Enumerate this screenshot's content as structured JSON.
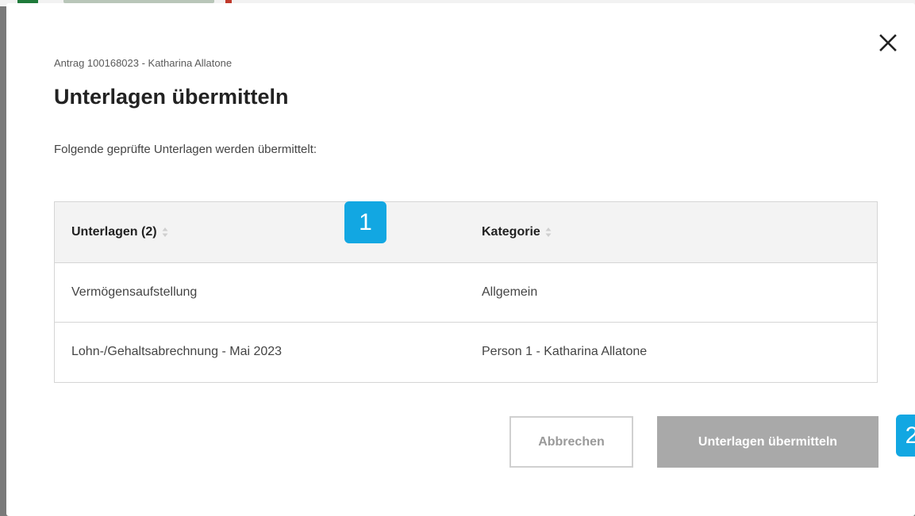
{
  "dialog": {
    "subtitle": "Antrag 100168023 - Katharina Allatone",
    "title": "Unterlagen übermitteln",
    "description": "Folgende geprüfte Unterlagen werden übermittelt:",
    "close_icon": "close-icon"
  },
  "table": {
    "columns": [
      {
        "label": "Unterlagen (2)",
        "sort_icon": "sort-icon"
      },
      {
        "label": "Kategorie",
        "sort_icon": "sort-icon"
      }
    ],
    "rows": [
      {
        "document": "Vermögensaufstellung",
        "category": "Allgemein"
      },
      {
        "document": "Lohn-/Gehaltsabrechnung - Mai 2023",
        "category": "Person 1 - Katharina Allatone"
      }
    ]
  },
  "buttons": {
    "cancel_label": "Abbrechen",
    "submit_label": "Unterlagen übermitteln"
  },
  "callouts": {
    "first": "1",
    "second": "2"
  },
  "colors": {
    "callout": "#12a7e2",
    "submit_disabled": "#a9a9a9",
    "header_background": "#f3f3f3"
  }
}
